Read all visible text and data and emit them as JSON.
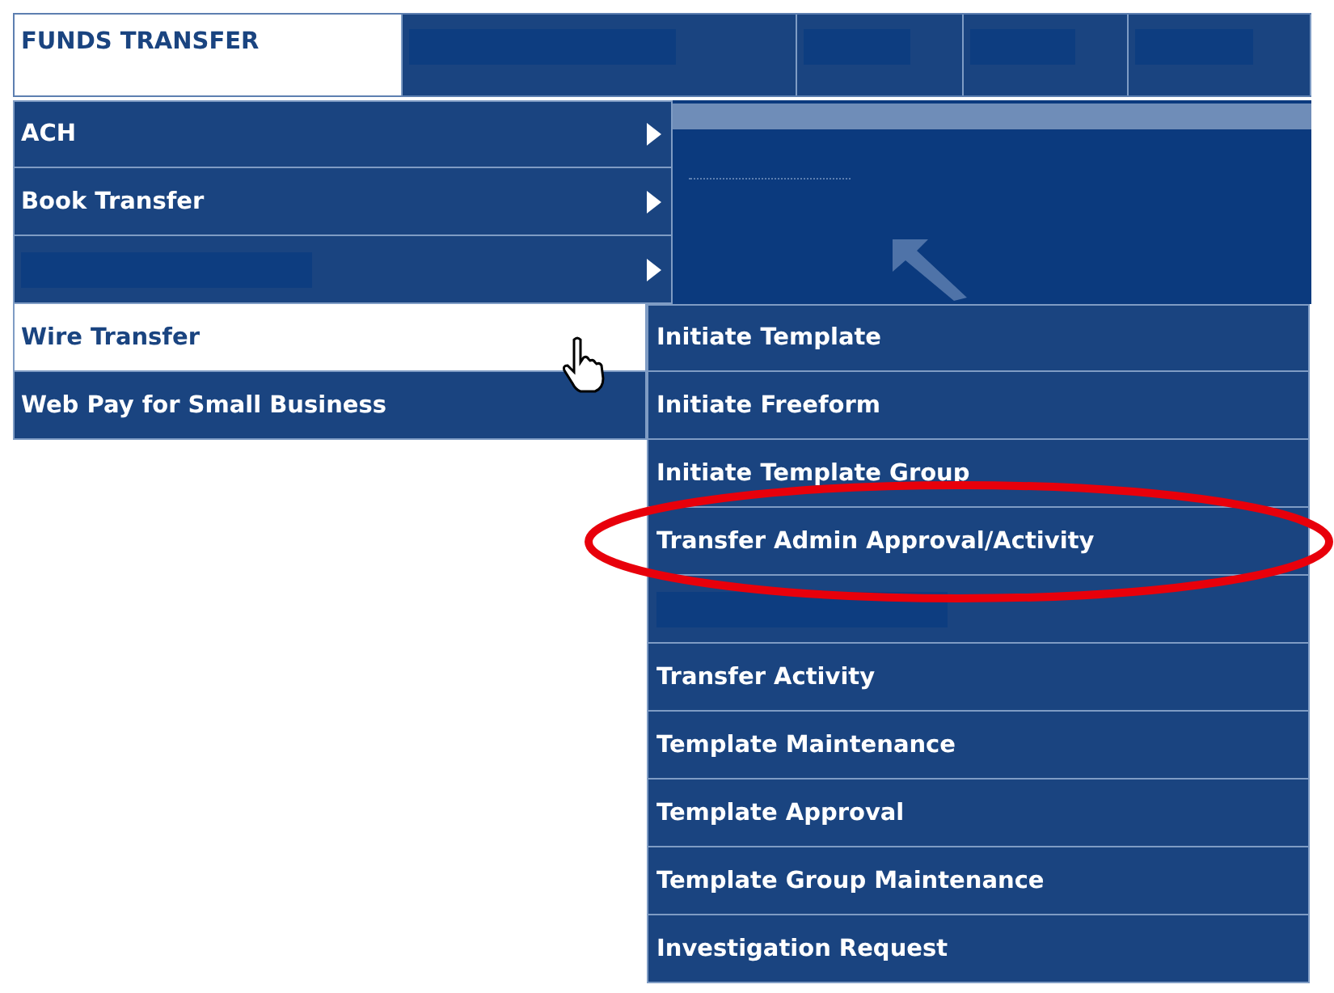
{
  "top_tabs": [
    {
      "label": "FUNDS TRANSFER",
      "selected": true,
      "kind": "text"
    },
    {
      "kind": "redacted",
      "selected": false
    },
    {
      "kind": "redacted",
      "selected": false
    },
    {
      "kind": "redacted",
      "selected": false
    },
    {
      "kind": "redacted",
      "selected": false
    }
  ],
  "menu": [
    {
      "label": "ACH",
      "kind": "text",
      "has_submenu": true,
      "selected": false
    },
    {
      "label": "Book Transfer",
      "kind": "text",
      "has_submenu": true,
      "selected": false
    },
    {
      "kind": "redacted",
      "has_submenu": true,
      "selected": false
    },
    {
      "label": "Wire Transfer",
      "kind": "text",
      "has_submenu": false,
      "selected": true
    },
    {
      "label": "Web Pay for Small Business",
      "kind": "text",
      "has_submenu": false,
      "selected": false
    }
  ],
  "submenu": [
    {
      "label": "Initiate Template",
      "kind": "text",
      "highlighted": false
    },
    {
      "label": "Initiate Freeform",
      "kind": "text",
      "highlighted": false
    },
    {
      "label": "Initiate Template Group",
      "kind": "text",
      "highlighted": false
    },
    {
      "label": "Transfer Admin Approval/Activity",
      "kind": "text",
      "highlighted": true
    },
    {
      "kind": "redacted",
      "highlighted": false
    },
    {
      "label": "Transfer Activity",
      "kind": "text",
      "highlighted": false
    },
    {
      "label": "Template Maintenance",
      "kind": "text",
      "highlighted": false
    },
    {
      "label": "Template Approval",
      "kind": "text",
      "highlighted": false
    },
    {
      "label": "Template Group Maintenance",
      "kind": "text",
      "highlighted": false
    },
    {
      "label": "Investigation Request",
      "kind": "text",
      "highlighted": false
    }
  ]
}
